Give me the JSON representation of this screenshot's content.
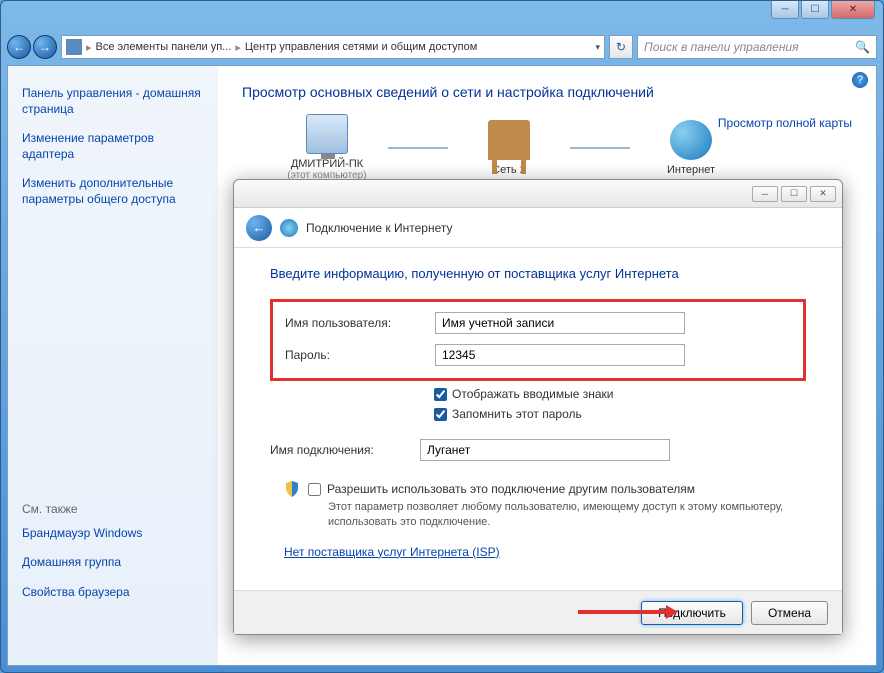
{
  "window": {
    "breadcrumb_root": "Все элементы панели уп...",
    "breadcrumb_current": "Центр управления сетями и общим доступом",
    "search_placeholder": "Поиск в панели управления"
  },
  "sidebar": {
    "home": "Панель управления - домашняя страница",
    "links": [
      "Изменение параметров адаптера",
      "Изменить дополнительные параметры общего доступа"
    ],
    "see_also_label": "См. также",
    "see_also": [
      "Брандмауэр Windows",
      "Домашняя группа",
      "Свойства браузера"
    ]
  },
  "main": {
    "heading": "Просмотр основных сведений о сети и настройка подключений",
    "map_full": "Просмотр полной карты",
    "nodes": {
      "pc": "ДМИТРИЙ-ПК",
      "pc_sub": "(этот компьютер)",
      "net": "Сеть 2",
      "internet": "Интернет"
    }
  },
  "dialog": {
    "title": "Подключение к Интернету",
    "heading": "Введите информацию, полученную от поставщика услуг Интернета",
    "labels": {
      "username": "Имя пользователя:",
      "password": "Пароль:",
      "show_chars": "Отображать вводимые знаки",
      "remember": "Запомнить этот пароль",
      "conn_name": "Имя подключения:",
      "allow_others": "Разрешить использовать это подключение другим пользователям",
      "allow_hint": "Этот параметр позволяет любому пользователю, имеющему доступ к этому компьютеру, использовать это подключение.",
      "no_isp": "Нет поставщика услуг Интернета (ISP)"
    },
    "values": {
      "username": "Имя учетной записи",
      "password": "12345",
      "conn_name": "Луганет"
    },
    "buttons": {
      "connect": "Подключить",
      "cancel": "Отмена"
    }
  }
}
